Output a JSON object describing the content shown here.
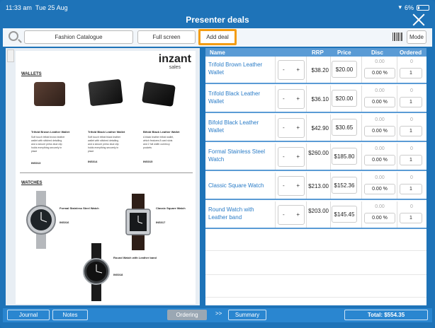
{
  "status": {
    "time": "11:33 am",
    "date": "Tue 25 Aug",
    "battery": "6%"
  },
  "header": {
    "title": "Presenter deals"
  },
  "toolbar": {
    "catalogue_label": "Fashion Catalogue",
    "fullscreen_label": "Full screen",
    "add_deal_label": "Add deal",
    "mode_label": "Mode"
  },
  "document": {
    "logo_text": "inzant",
    "logo_sub": "sales",
    "wallets_heading": "WALLETS",
    "watches_heading": "WATCHES",
    "wallets": [
      {
        "name": "Trifold Brown Leather Wallet",
        "desc": "Soft touch trifold brown leather wallet with stitched detailing and a secure press stud clip holds everything securely in place",
        "code": "INS013"
      },
      {
        "name": "Trifold Black Leather Wallet",
        "desc": "Soft touch trifold black leather wallet with stitched detailing and a secure press stud clip holds everything securely in place",
        "code": "INS014"
      },
      {
        "name": "Bifold Black Leather Wallet",
        "desc": "A black leather bifold wallet, which features 8 card slots and 2 full width currency pockets",
        "code": "INS015"
      }
    ],
    "watches": [
      {
        "name": "Formal Stainless Steel Watch",
        "code": "INS016"
      },
      {
        "name": "Classic Square Watch",
        "code": "INS017"
      },
      {
        "name": "Round Watch with Leather band",
        "code": "INS018"
      }
    ]
  },
  "table": {
    "headers": {
      "name": "Name",
      "rrp": "RRP",
      "price": "Price",
      "disc": "Disc",
      "ordered": "Ordered"
    },
    "rows": [
      {
        "name": "Trifold Brown Leather Wallet",
        "rrp": "$38.20",
        "price": "$20.00",
        "disc_amount": "0.00",
        "disc_pct": "0.00 %",
        "ordered_small": "0",
        "ordered": "1"
      },
      {
        "name": "Trifold Black Leather Wallet",
        "rrp": "$36.10",
        "price": "$20.00",
        "disc_amount": "0.00",
        "disc_pct": "0.00 %",
        "ordered_small": "0",
        "ordered": "1"
      },
      {
        "name": "Bifold Black Leather Wallet",
        "rrp": "$42.90",
        "price": "$30.65",
        "disc_amount": "0.00",
        "disc_pct": "0.00 %",
        "ordered_small": "0",
        "ordered": "1"
      },
      {
        "name": "Formal Stainless Steel Watch",
        "rrp": "$260.00",
        "price": "$185.80",
        "disc_amount": "0.00",
        "disc_pct": "0.00 %",
        "ordered_small": "0",
        "ordered": "1"
      },
      {
        "name": "Classic Square Watch",
        "rrp": "$213.00",
        "price": "$152.36",
        "disc_amount": "0.00",
        "disc_pct": "0.00 %",
        "ordered_small": "0",
        "ordered": "1"
      },
      {
        "name": "Round Watch with Leather band",
        "rrp": "$203.00",
        "price": "$145.45",
        "disc_amount": "0.00",
        "disc_pct": "0.00 %",
        "ordered_small": "0",
        "ordered": "1"
      }
    ],
    "minus": "-",
    "plus": "+"
  },
  "bottom": {
    "journal": "Journal",
    "notes": "Notes",
    "ordering": "Ordering",
    "chevron": ">>",
    "summary": "Summary",
    "total": "Total: $554.35"
  },
  "colors": {
    "brand": "#1e73b8",
    "highlight": "#f39c12",
    "header_row": "#5a9bd5"
  }
}
